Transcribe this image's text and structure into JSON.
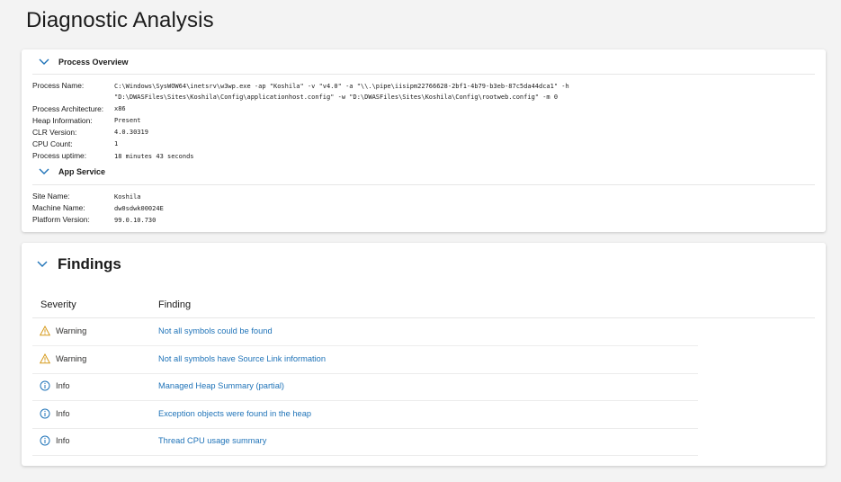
{
  "page": {
    "title": "Diagnostic Analysis"
  },
  "process_overview": {
    "label": "Process Overview",
    "rows": [
      {
        "key": "Process Name:",
        "value": "C:\\Windows\\SysWOW64\\inetsrv\\w3wp.exe -ap \"Koshila\" -v \"v4.0\" -a \"\\\\.\\pipe\\iisipm22766628-2bf1-4b79-b3eb-87c5da44dca1\" -h \"D:\\DWASFiles\\Sites\\Koshila\\Config\\applicationhost.config\" -w \"D:\\DWASFiles\\Sites\\Koshila\\Config\\rootweb.config\" -m 0"
      },
      {
        "key": "Process Architecture:",
        "value": "x86"
      },
      {
        "key": "Heap Information:",
        "value": "Present"
      },
      {
        "key": "CLR Version:",
        "value": "4.0.30319"
      },
      {
        "key": "CPU Count:",
        "value": "1"
      },
      {
        "key": "Process uptime:",
        "value": "18 minutes 43 seconds"
      }
    ]
  },
  "app_service": {
    "label": "App Service",
    "rows": [
      {
        "key": "Site Name:",
        "value": "Koshila"
      },
      {
        "key": "Machine Name:",
        "value": "dw0sdwk00024E"
      },
      {
        "key": "Platform Version:",
        "value": "99.0.10.730"
      }
    ]
  },
  "findings": {
    "title": "Findings",
    "columns": {
      "severity": "Severity",
      "finding": "Finding"
    },
    "rows": [
      {
        "severity": "Warning",
        "icon": "warning-icon",
        "finding": "Not all symbols could be found"
      },
      {
        "severity": "Warning",
        "icon": "warning-icon",
        "finding": "Not all symbols have Source Link information"
      },
      {
        "severity": "Info",
        "icon": "info-icon",
        "finding": "Managed Heap Summary (partial)"
      },
      {
        "severity": "Info",
        "icon": "info-icon",
        "finding": "Exception objects were found in the heap"
      },
      {
        "severity": "Info",
        "icon": "info-icon",
        "finding": "Thread CPU usage summary"
      }
    ]
  },
  "colors": {
    "link": "#1f73b8",
    "warning": "#d69a1b",
    "info": "#1f73b8",
    "chevron": "#1f73b8"
  }
}
